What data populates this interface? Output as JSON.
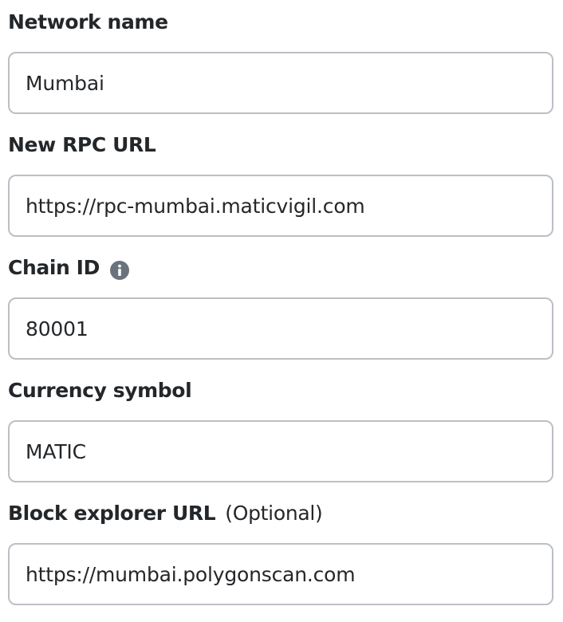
{
  "form": {
    "network_name": {
      "label": "Network name",
      "value": "Mumbai"
    },
    "rpc_url": {
      "label": "New RPC URL",
      "value": "https://rpc-mumbai.maticvigil.com"
    },
    "chain_id": {
      "label": "Chain ID",
      "info_icon": "info-icon",
      "value": "80001"
    },
    "currency_symbol": {
      "label": "Currency symbol",
      "value": "MATIC"
    },
    "block_explorer": {
      "label": "Block explorer URL",
      "optional_text": "(Optional)",
      "value": "https://mumbai.polygonscan.com"
    }
  },
  "colors": {
    "text": "#24272a",
    "input_border": "#bbc0c5",
    "icon": "#6a737d",
    "background": "#ffffff"
  }
}
